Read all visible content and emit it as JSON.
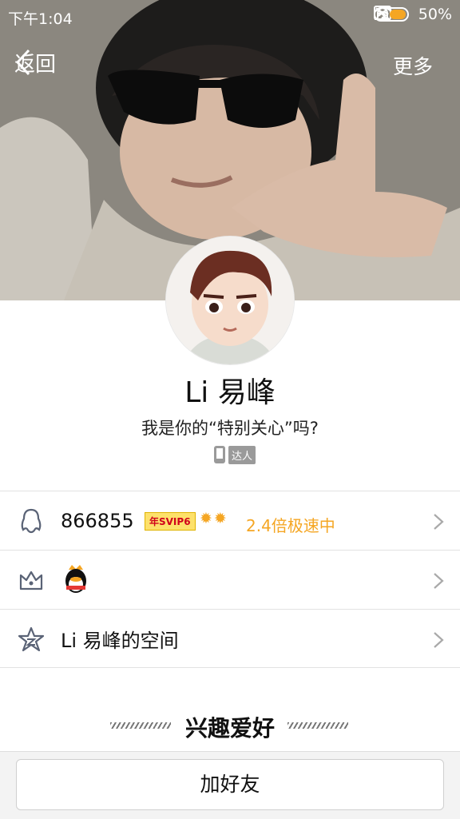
{
  "status_bar": {
    "time": "下午1:04",
    "battery": "50%"
  },
  "nav": {
    "back_label": "返回",
    "more_label": "更多"
  },
  "profile": {
    "nickname": "Li 易峰",
    "signature": "我是你的“特别关心”吗?",
    "badge_label": "达人"
  },
  "rows": {
    "qq": {
      "number": "866855",
      "vip_badge": "年SVIP6",
      "speed_text": "2.4倍极速中"
    },
    "space": {
      "label": "Li 易峰的空间"
    }
  },
  "section": {
    "title": "兴趣爱好"
  },
  "actions": {
    "add_friend": "加好友"
  },
  "colors": {
    "accent_orange": "#f5a623",
    "vip_bg": "#fde16b"
  }
}
